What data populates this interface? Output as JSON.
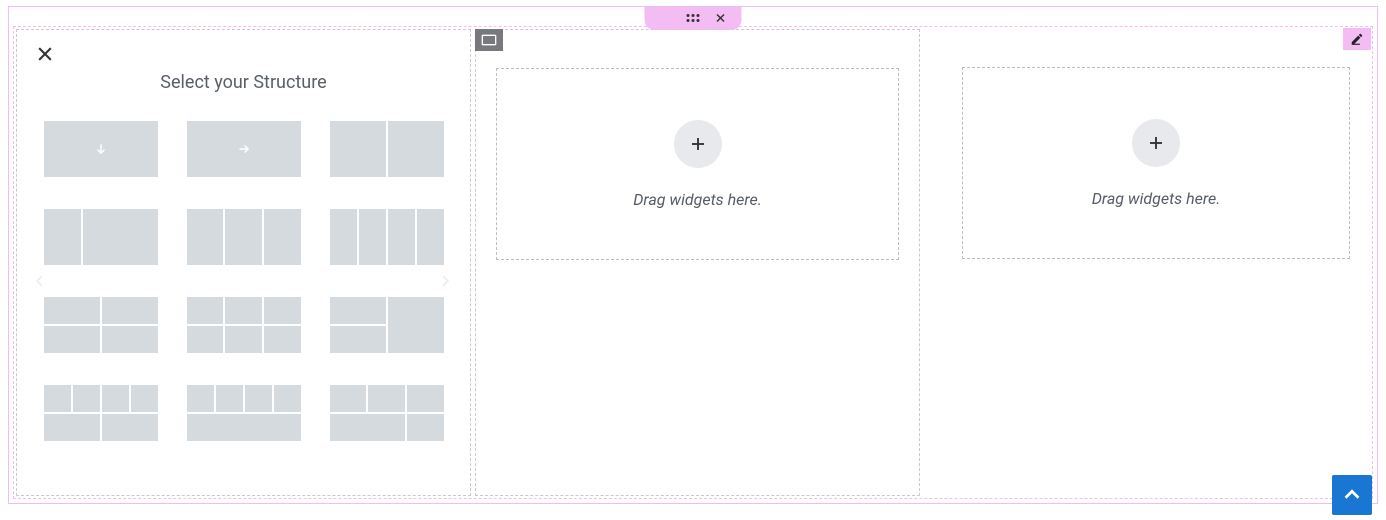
{
  "section_tab": {
    "add_icon": "plus-icon",
    "drag_icon": "drag-handle-icon",
    "close_icon": "close-icon"
  },
  "structure_panel": {
    "title": "Select your Structure",
    "close_icon": "close-icon",
    "prev_icon": "chevron-left-icon",
    "next_icon": "chevron-right-icon",
    "options": [
      {
        "id": "one-col-down",
        "layout": "1",
        "arrow": "down"
      },
      {
        "id": "one-col-right",
        "layout": "1",
        "arrow": "right"
      },
      {
        "id": "two-col",
        "layout": "1|1"
      },
      {
        "id": "one-two",
        "layout": "1|2"
      },
      {
        "id": "three-col",
        "layout": "1|1|1"
      },
      {
        "id": "four-col",
        "layout": "1|1|1|1"
      },
      {
        "id": "row2-a",
        "layout": "2x:1,1/1,1"
      },
      {
        "id": "row2-b",
        "layout": "2x:1,1,1/1,1,1"
      },
      {
        "id": "row2-c",
        "layout": "2x:1,1/span2"
      },
      {
        "id": "row2-d",
        "layout": "2x:1,1,1,1/1,1,1,1"
      },
      {
        "id": "row2-e",
        "layout": "2x:1,1,1,1/span4"
      },
      {
        "id": "row2-f",
        "layout": "2x:1,1,1/span3,1"
      }
    ]
  },
  "columns": [
    {
      "badge_icon": "column-icon",
      "dropzone": {
        "add_icon": "plus-icon",
        "hint": "Drag widgets here."
      }
    },
    {
      "badge_icon": "edit-icon",
      "dropzone": {
        "add_icon": "plus-icon",
        "hint": "Drag widgets here."
      }
    }
  ],
  "scroll_to_top": {
    "icon": "chevron-up-icon"
  },
  "colors": {
    "accent_pink": "#f3bdf3",
    "scrolltop_blue": "#1976d2",
    "cell_gray": "#d5dadf"
  }
}
